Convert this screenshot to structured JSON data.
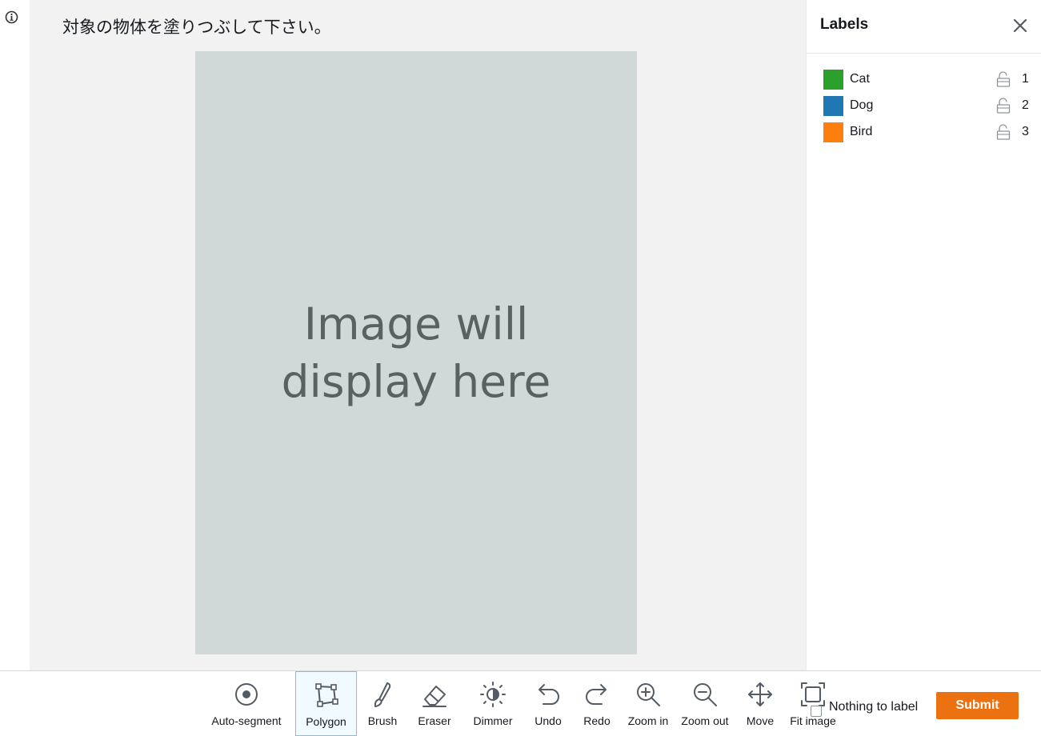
{
  "instruction": "対象の物体を塗りつぶして下さい。",
  "image_placeholder": {
    "line1": "Image will",
    "line2": "display here"
  },
  "panel": {
    "title": "Labels",
    "labels": [
      {
        "name": "Cat",
        "color": "#2ca02c",
        "shortcut": "1",
        "icon": "unlock-icon"
      },
      {
        "name": "Dog",
        "color": "#1f77b4",
        "shortcut": "2",
        "icon": "unlock-icon"
      },
      {
        "name": "Bird",
        "color": "#ff7f0e",
        "shortcut": "3",
        "icon": "unlock-icon"
      }
    ]
  },
  "toolbar": {
    "tools": [
      {
        "label": "Auto-segment",
        "icon": "auto-segment-icon"
      },
      {
        "label": "Polygon",
        "icon": "polygon-icon",
        "active": true
      },
      {
        "label": "Brush",
        "icon": "brush-icon"
      },
      {
        "label": "Eraser",
        "icon": "eraser-icon"
      },
      {
        "label": "Dimmer",
        "icon": "dimmer-icon"
      },
      {
        "label": "Undo",
        "icon": "undo-icon"
      },
      {
        "label": "Redo",
        "icon": "redo-icon"
      },
      {
        "label": "Zoom in",
        "icon": "zoom-in-icon"
      },
      {
        "label": "Zoom out",
        "icon": "zoom-out-icon"
      },
      {
        "label": "Move",
        "icon": "move-icon"
      },
      {
        "label": "Fit image",
        "icon": "fit-image-icon"
      }
    ],
    "nothing_to_label": "Nothing to label",
    "submit_label": "Submit"
  },
  "colors": {
    "accent": "#ec7211",
    "workspace_bg": "#f1f2f1",
    "image_bg": "#d0d8d8",
    "active_tool_bg": "#f1faff"
  }
}
